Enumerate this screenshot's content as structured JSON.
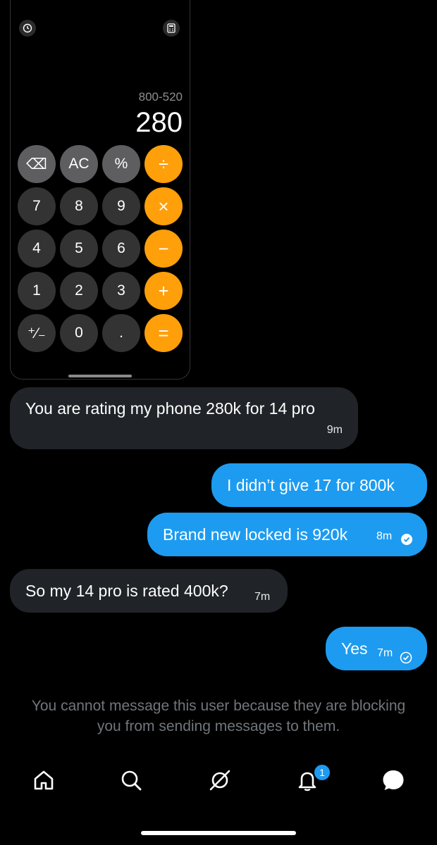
{
  "calculator": {
    "expression": "800-520",
    "result": "280",
    "keys": [
      {
        "label": "⌫",
        "style": "gray"
      },
      {
        "label": "AC",
        "style": "gray"
      },
      {
        "label": "%",
        "style": "gray"
      },
      {
        "label": "÷",
        "style": "orange"
      },
      {
        "label": "7",
        "style": "dark"
      },
      {
        "label": "8",
        "style": "dark"
      },
      {
        "label": "9",
        "style": "dark"
      },
      {
        "label": "×",
        "style": "orange"
      },
      {
        "label": "4",
        "style": "dark"
      },
      {
        "label": "5",
        "style": "dark"
      },
      {
        "label": "6",
        "style": "dark"
      },
      {
        "label": "−",
        "style": "orange"
      },
      {
        "label": "1",
        "style": "dark"
      },
      {
        "label": "2",
        "style": "dark"
      },
      {
        "label": "3",
        "style": "dark"
      },
      {
        "label": "+",
        "style": "orange"
      },
      {
        "label": "⁺∕₋",
        "style": "dark"
      },
      {
        "label": "0",
        "style": "dark"
      },
      {
        "label": ".",
        "style": "dark"
      },
      {
        "label": "=",
        "style": "orange"
      }
    ]
  },
  "messages": [
    {
      "text": "You are rating my phone 280k for 14 pro",
      "time": "9m",
      "direction": "incoming"
    },
    {
      "text": "I didn’t give 17 for 800k",
      "time": "",
      "direction": "outgoing"
    },
    {
      "text": "Brand new locked is 920k",
      "time": "8m",
      "direction": "outgoing",
      "seen": true
    },
    {
      "text": "So my 14 pro is rated 400k?",
      "time": "7m",
      "direction": "incoming"
    },
    {
      "text": "Yes",
      "time": "7m",
      "direction": "outgoing",
      "seen": true
    }
  ],
  "blocked_notice": "You cannot message this user because they are blocking you from sending messages to them.",
  "tabbar": {
    "items": [
      "home-icon",
      "search-icon",
      "grok-icon",
      "bell-icon",
      "messages-icon"
    ],
    "notification_count": "1"
  },
  "colors": {
    "accent": "#1d9bf0",
    "incoming_bubble": "#202327",
    "calc_orange": "#ff9f0a"
  }
}
